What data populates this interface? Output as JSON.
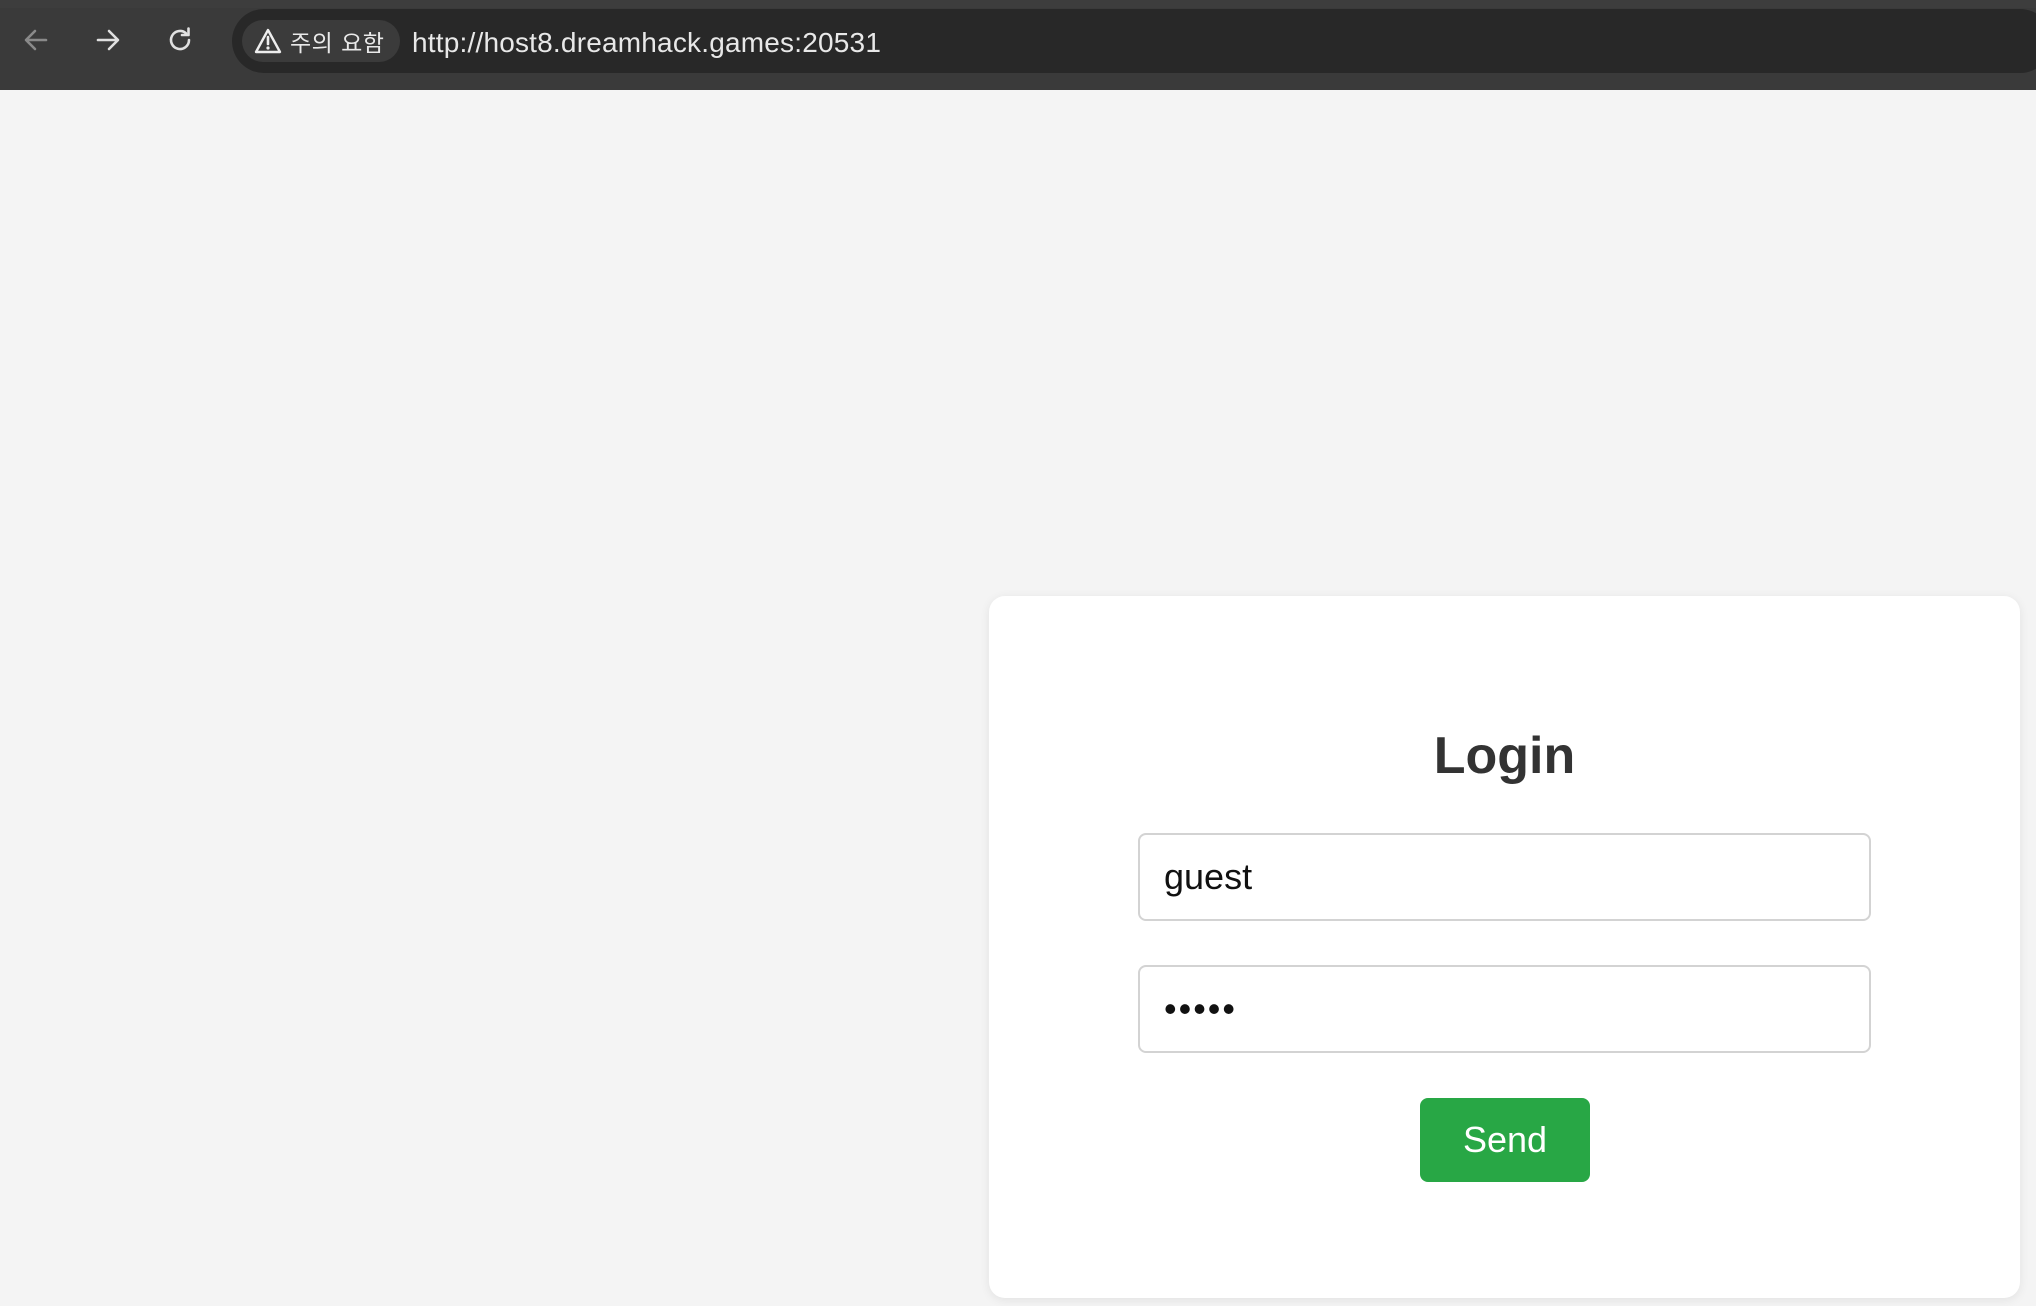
{
  "browser": {
    "security_chip": {
      "label": "주의 요함",
      "icon": "warning-triangle-icon"
    },
    "url": "http://host8.dreamhack.games:20531",
    "nav_icons": [
      "back-arrow-icon",
      "forward-arrow-icon",
      "reload-icon"
    ],
    "colors": {
      "toolbar": "#3a3a3a",
      "address_bar": "#282828",
      "chip": "#3b3b3b"
    }
  },
  "login": {
    "title": "Login",
    "username_value": "guest",
    "password_value": "•••••",
    "send_label": "Send",
    "colors": {
      "button": "#28a745",
      "card": "#ffffff",
      "page_background": "#f4f4f4"
    }
  }
}
